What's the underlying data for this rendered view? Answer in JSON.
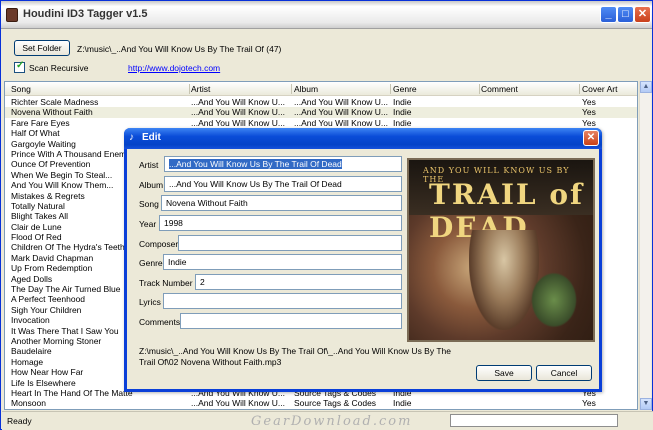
{
  "window": {
    "title": "Houdini ID3 Tagger v1.5",
    "min": "_",
    "max": "□",
    "close": "✕"
  },
  "toolbar": {
    "set_folder_label": "Set Folder",
    "path": "Z:\\music\\_..And You Will Know Us By The Trail Of (47)",
    "scan_recursive_label": "Scan Recursive",
    "scan_recursive_checked": true,
    "link": "http://www.dojotech.com"
  },
  "list": {
    "columns": [
      "Song",
      "Artist",
      "Album",
      "Genre",
      "Comment",
      "Cover Art"
    ],
    "rows": [
      [
        "Richter Scale Madness",
        "...And You Will Know U...",
        "...And You Will Know U...",
        "Indie",
        "",
        "Yes"
      ],
      [
        "Novena Without Faith",
        "...And You Will Know U...",
        "...And You Will Know U...",
        "Indie",
        "",
        "Yes"
      ],
      [
        "Fare Fare Eyes",
        "...And You Will Know U...",
        "...And You Will Know U...",
        "Indie",
        "",
        "Yes"
      ],
      [
        "Half Of What",
        "",
        "",
        "",
        "",
        ""
      ],
      [
        "Gargoyle Waiting",
        "",
        "",
        "",
        "",
        ""
      ],
      [
        "Prince With A Thousand Enemie",
        "",
        "",
        "",
        "",
        ""
      ],
      [
        "Ounce Of Prevention",
        "",
        "",
        "",
        "",
        ""
      ],
      [
        "When We Begin To Steal...",
        "",
        "",
        "",
        "",
        ""
      ],
      [
        "And You Will Know Them...",
        "",
        "",
        "",
        "",
        ""
      ],
      [
        "Mistakes & Regrets",
        "",
        "",
        "",
        "",
        ""
      ],
      [
        "Totally Natural",
        "",
        "",
        "",
        "",
        ""
      ],
      [
        "Blight Takes All",
        "",
        "",
        "",
        "",
        ""
      ],
      [
        "Clair de Lune",
        "",
        "",
        "",
        "",
        ""
      ],
      [
        "Flood Of Red",
        "",
        "",
        "",
        "",
        ""
      ],
      [
        "Children Of The Hydra's Teeth",
        "",
        "",
        "",
        "",
        ""
      ],
      [
        "Mark David Chapman",
        "",
        "",
        "",
        "",
        ""
      ],
      [
        "Up From Redemption",
        "",
        "",
        "",
        "",
        ""
      ],
      [
        "Aged Dolls",
        "",
        "",
        "",
        "",
        ""
      ],
      [
        "The Day The Air Turned Blue",
        "",
        "",
        "",
        "",
        ""
      ],
      [
        "A Perfect Teenhood",
        "",
        "",
        "",
        "",
        ""
      ],
      [
        "Sigh Your Children",
        "",
        "",
        "",
        "",
        ""
      ],
      [
        "Invocation",
        "",
        "",
        "",
        "",
        ""
      ],
      [
        "It Was There That I Saw You",
        "",
        "",
        "",
        "",
        ""
      ],
      [
        "Another Morning Stoner",
        "",
        "",
        "",
        "",
        ""
      ],
      [
        "Baudelaire",
        "",
        "",
        "",
        "",
        ""
      ],
      [
        "Homage",
        "",
        "",
        "",
        "",
        ""
      ],
      [
        "How Near How Far",
        "",
        "",
        "",
        "",
        ""
      ],
      [
        "Life Is Elsewhere",
        "",
        "",
        "",
        "",
        ""
      ],
      [
        "Heart In The Hand Of The Matte",
        "...And You Will Know U...",
        "Source Tags & Codes",
        "Indie",
        "",
        "Yes"
      ],
      [
        "Monsoon",
        "...And You Will Know U...",
        "Source Tags & Codes",
        "Indie",
        "",
        "Yes"
      ]
    ]
  },
  "status": {
    "text": "Ready",
    "watermark": "GearDownload.com"
  },
  "dialog": {
    "title": "Edit",
    "close": "✕",
    "fields": {
      "artist_label": "Artist",
      "artist": "...And You Will Know Us By The Trail Of Dead",
      "album_label": "Album",
      "album": "...And You Will Know Us By The Trail Of Dead",
      "song_label": "Song",
      "song": "Novena Without Faith",
      "year_label": "Year",
      "year": "1998",
      "composer_label": "Composer",
      "composer": "",
      "genre_label": "Genre",
      "genre": "Indie",
      "track_label": "Track Number",
      "track": "2",
      "lyrics_label": "Lyrics",
      "lyrics": "",
      "comments_label": "Comments",
      "comments": ""
    },
    "filepath": "Z:\\music\\_..And You Will Know Us By The Trail Of\\_..And You Will Know Us By The Trail Of\\02 Novena Without Faith.mp3",
    "save_label": "Save",
    "cancel_label": "Cancel"
  }
}
